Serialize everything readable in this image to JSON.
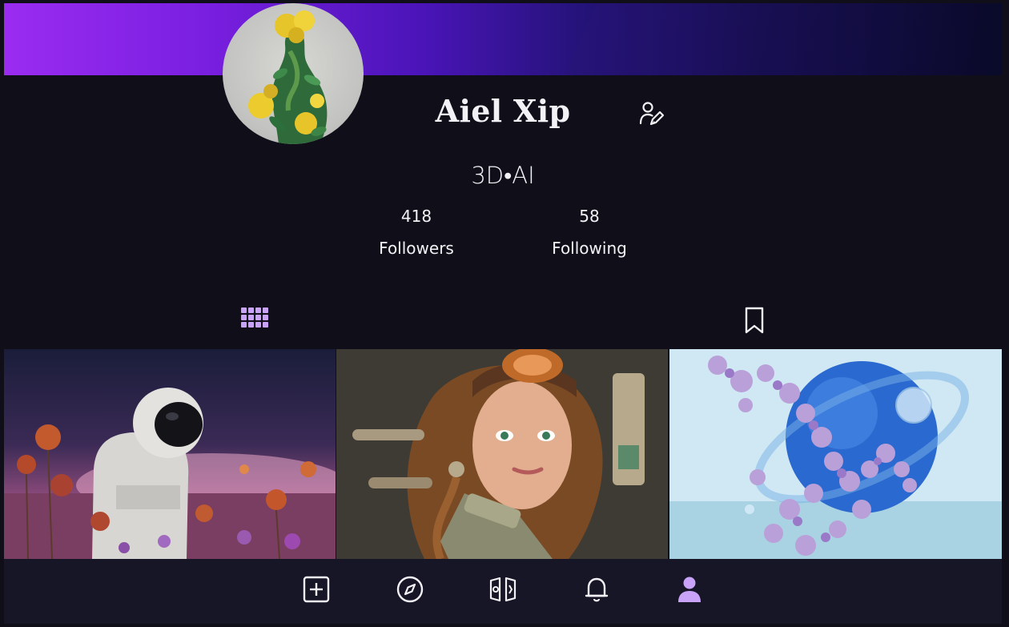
{
  "profile": {
    "name": "Aiel Xip",
    "bio": "3D•AI",
    "followers_count": "418",
    "followers_label": "Followers",
    "following_count": "58",
    "following_label": "Following"
  },
  "tabs": [
    {
      "icon": "grid-icon",
      "active": true
    },
    {
      "icon": "bookmark-icon",
      "active": false
    }
  ],
  "gallery": [
    {
      "subject": "astronaut in flower field"
    },
    {
      "subject": "steampunk woman portrait"
    },
    {
      "subject": "blue sphere with purple flowers"
    }
  ],
  "nav": [
    {
      "icon": "add-post-icon"
    },
    {
      "icon": "compass-icon"
    },
    {
      "icon": "reels-icon"
    },
    {
      "icon": "bell-icon"
    },
    {
      "icon": "profile-icon",
      "active": true
    }
  ],
  "colors": {
    "background": "#0f0e19",
    "navbar": "#171626",
    "accent": "#c9a3f7",
    "text": "#f2f2f6",
    "cover_start": "#9a2cf0",
    "cover_end": "#0a0a2a"
  }
}
